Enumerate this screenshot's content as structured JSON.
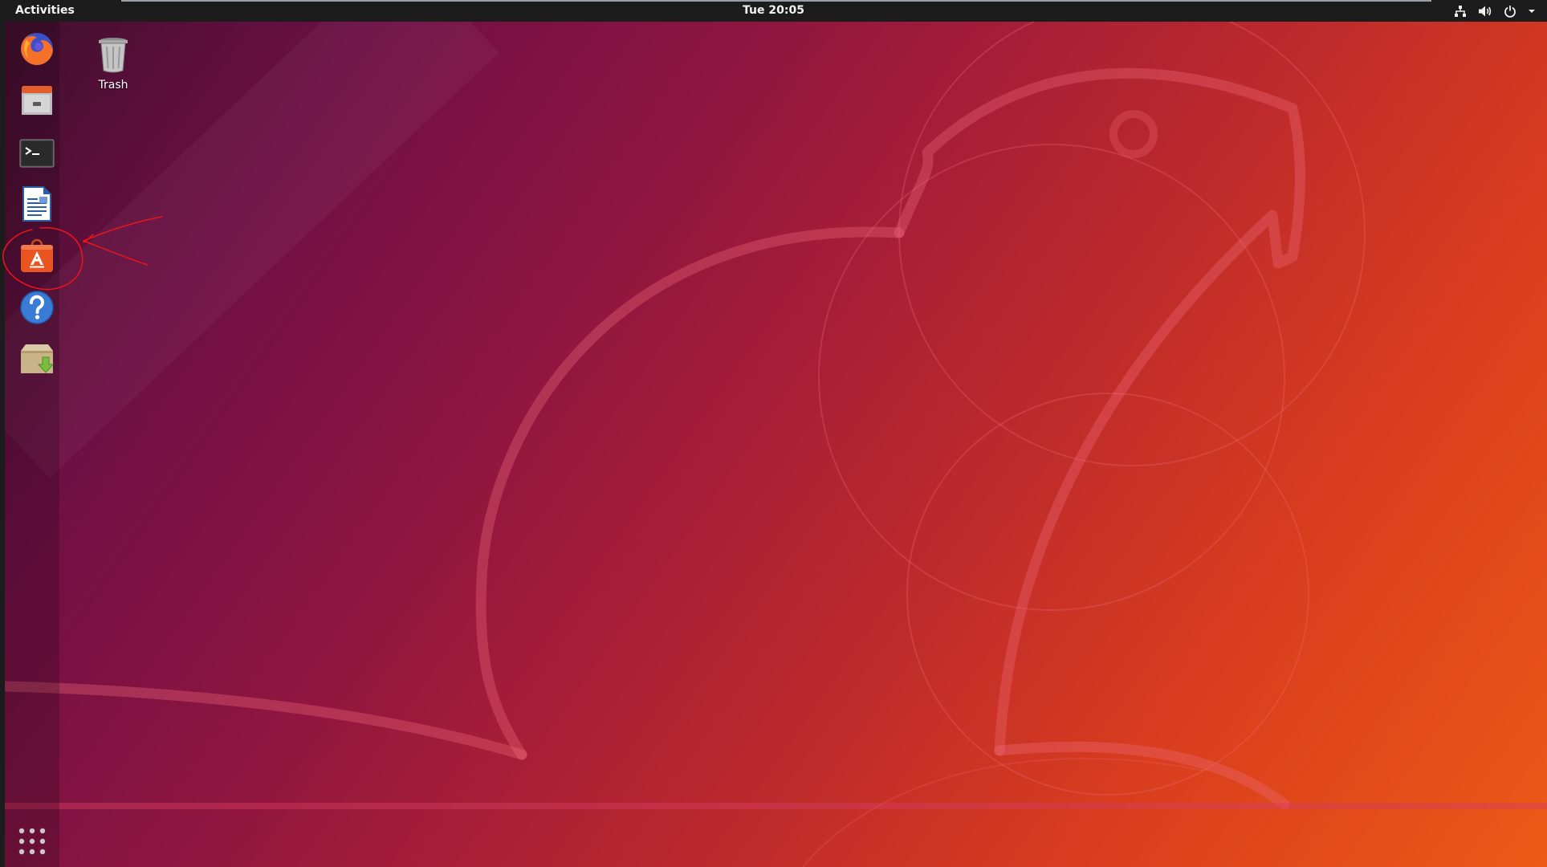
{
  "top_bar": {
    "activities_label": "Activities",
    "clock": "Tue 20:05",
    "icons": [
      "network-icon",
      "volume-icon",
      "power-icon",
      "menu-arrow-icon"
    ]
  },
  "dock": {
    "items": [
      {
        "name": "Firefox Web Browser",
        "icon": "firefox-icon"
      },
      {
        "name": "Files",
        "icon": "files-icon"
      },
      {
        "name": "Terminal",
        "icon": "terminal-icon"
      },
      {
        "name": "LibreOffice Writer",
        "icon": "libreoffice-writer-icon"
      },
      {
        "name": "Ubuntu Software",
        "icon": "ubuntu-software-icon"
      },
      {
        "name": "Help",
        "icon": "help-icon"
      },
      {
        "name": "Software Updater",
        "icon": "software-updater-icon"
      }
    ],
    "show_apps_icon": "show-applications-icon"
  },
  "desktop": {
    "icons": [
      {
        "label": "Trash",
        "icon": "trash-icon"
      }
    ]
  },
  "colors": {
    "top_bar": "#1c1c1c",
    "accent_orange": "#e95420",
    "annotation_red": "#e8141b"
  }
}
